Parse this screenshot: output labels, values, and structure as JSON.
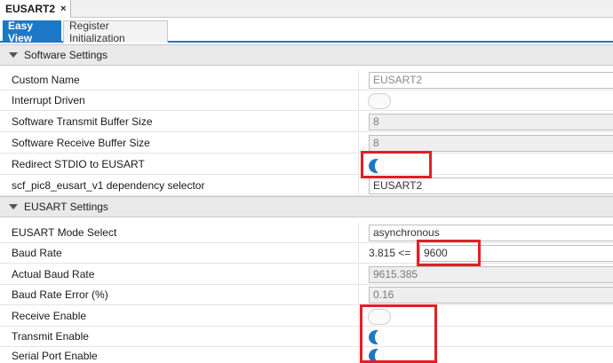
{
  "doc_tab": {
    "title": "EUSART2",
    "close_glyph": "×"
  },
  "sub_tabs": {
    "easy_view": "Easy View",
    "register_init": "Register Initialization"
  },
  "software_settings": {
    "header": "Software Settings",
    "custom_name": {
      "label": "Custom Name",
      "value": "EUSART2"
    },
    "interrupt_driven": {
      "label": "Interrupt Driven",
      "state": "off"
    },
    "tx_buffer": {
      "label": "Software Transmit Buffer Size",
      "value": "8"
    },
    "rx_buffer": {
      "label": "Software Receive Buffer Size",
      "value": "8"
    },
    "redirect_stdio": {
      "label": "Redirect STDIO to EUSART",
      "state": "on"
    },
    "dependency": {
      "label": "scf_pic8_eusart_v1 dependency selector",
      "value": "EUSART2"
    }
  },
  "eusart_settings": {
    "header": "EUSART Settings",
    "mode": {
      "label": "EUSART Mode Select",
      "value": "asynchronous"
    },
    "baud_rate": {
      "label": "Baud Rate",
      "prefix": "3.815  <=",
      "value": "9600"
    },
    "actual_baud": {
      "label": "Actual Baud Rate",
      "value": "9615.385"
    },
    "baud_error": {
      "label": "Baud Rate Error (%)",
      "value": "0.16"
    },
    "receive_enable": {
      "label": "Receive Enable",
      "state": "off"
    },
    "transmit_enable": {
      "label": "Transmit Enable",
      "state": "on"
    },
    "serial_port_enable": {
      "label": "Serial Port Enable",
      "state": "on"
    }
  },
  "colors": {
    "accent": "#1e78c8",
    "highlight": "#e31e26",
    "section_bg": "#e9e9e9"
  }
}
